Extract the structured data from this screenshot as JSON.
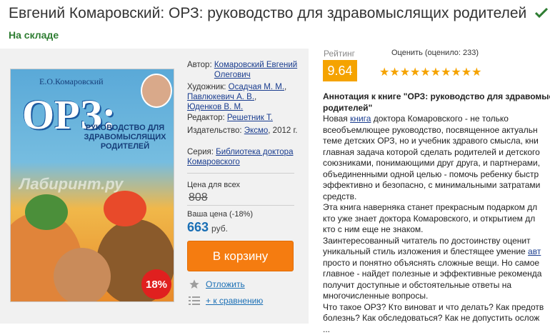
{
  "product": {
    "title": "Евгений Комаровский: ОРЗ: руководство для здравомыслящих родителей",
    "stock": "На складе"
  },
  "cover": {
    "author": "Е.О.Комаровский",
    "title_big": "ОРЗ:",
    "title_sub": "РУКОВОДСТВО ДЛЯ ЗДРАВОМЫСЛЯЩИХ РОДИТЕЛЕЙ",
    "watermark": "Лабиринт.ру",
    "discount_badge": "18%"
  },
  "details": {
    "author_label": "Автор:",
    "author_value": "Комаровский Евгений Олегович",
    "artist_label": "Художник:",
    "artist_1": "Осадчая М. М.",
    "artist_2": "Павлюкевич А. В.",
    "artist_3": "Юденков В. М.",
    "editor_label": "Редактор:",
    "editor_value": "Решетник Т.",
    "publisher_label": "Издательство:",
    "publisher_value": "Эксмо",
    "publisher_year": ", 2012 г.",
    "series_label": "Серия:",
    "series_value": "Библиотека доктора Комаровского"
  },
  "pricing": {
    "all_price_label": "Цена для всех",
    "old_price": "808",
    "your_price_label": "Ваша цена (-18%)",
    "new_price": "663",
    "currency": "руб.",
    "buy_button": "В корзину",
    "defer_label": "Отложить",
    "compare_label": "+ к сравнению"
  },
  "rating": {
    "label": "Рейтинг",
    "value": "9.64",
    "rate_label": "Оценить (оценило: 233)",
    "stars": 9.5,
    "stars_max": 10,
    "star_color": "#f5a300"
  },
  "annotation": {
    "heading_1": "Аннотация к книге \"ОРЗ: руководство для здравомыс",
    "heading_2": "родителей\"",
    "line_1a": "Новая ",
    "line_1_link": "книга",
    "line_1b": " доктора Комаровского - не только",
    "line_2": "всеобъемлющее руководство, посвященное актуальн",
    "line_3": "теме детских ОРЗ, но и учебник здравого смысла, кни",
    "line_4": "главная задача которой сделать родителей и детского",
    "line_5": "союзниками, понимающими друг друга, и партнерами,",
    "line_6": "объединенными одной целью - помочь ребенку быстр",
    "line_7": "эффективно и безопасно, с минимальными затратами",
    "line_8": "средств.",
    "line_9": "Эта книга наверняка станет прекрасным подарком дл",
    "line_10": "кто уже знает доктора Комаровского, и открытием дл",
    "line_11": "кто с ним еще не знаком.",
    "line_12": "Заинтересованный читатель по достоинству оценит",
    "line_13a": "уникальный стиль изложения и блестящее умение ",
    "line_13_link": "авт",
    "line_14": "просто и понятно объяснять сложные вещи. Но самое",
    "line_15": "главное - найдет полезные и эффективные рекоменда",
    "line_16": "получит доступные и обстоятельные ответы на",
    "line_17": "многочисленные вопросы.",
    "line_18": "Что такое ОРЗ? Кто виноват и что делать? Как предотв",
    "line_19": "болезнь? Как обследоваться? Как не допустить ослож",
    "line_20": "..."
  }
}
